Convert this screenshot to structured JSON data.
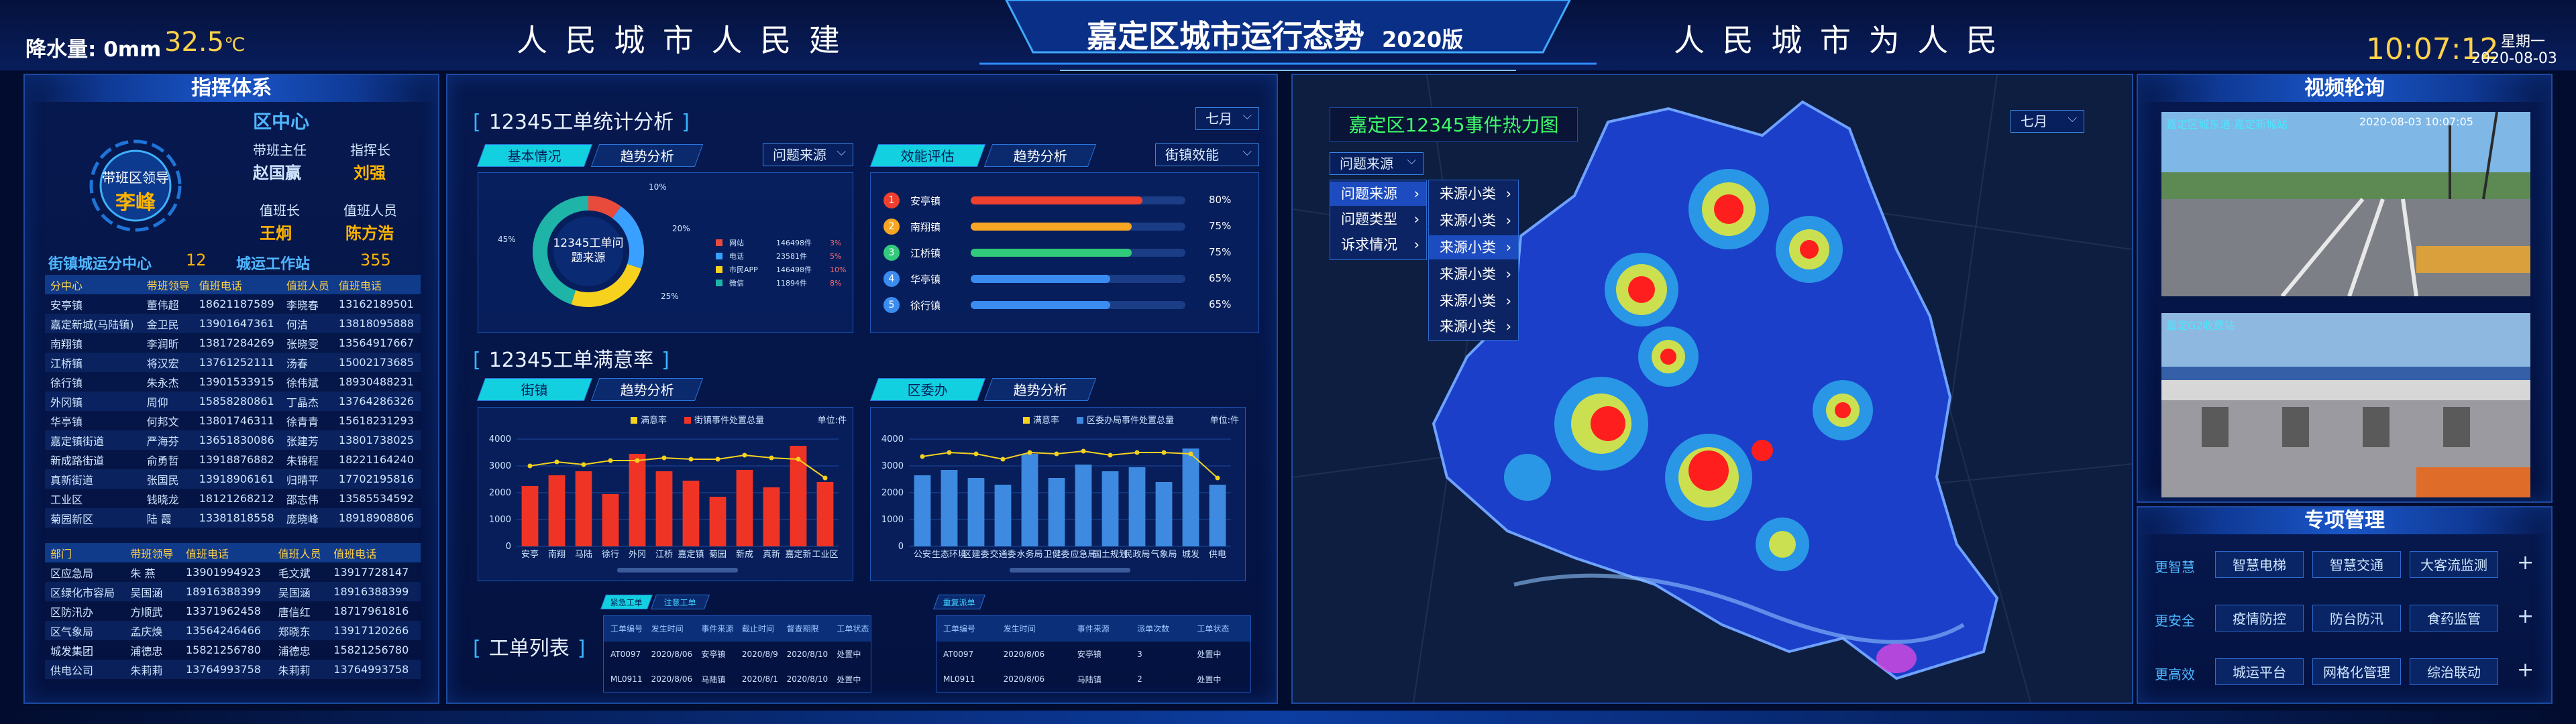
{
  "header": {
    "rain_label": "降水量: 0mm",
    "temp": "32.5",
    "temp_unit": "℃",
    "slogan_left": "人 民 城 市 人 民 建",
    "title": "嘉定区城市运行态势",
    "title_year": "2020版",
    "slogan_right": "人 民 城 市 为 人 民",
    "time": "10:07:12",
    "weekday": "星期一",
    "date": "2020-08-03"
  },
  "command": {
    "title": "指挥体系",
    "center": "区中心",
    "leader_role": "带班区领导",
    "leader_name": "李峰",
    "duty_director_label": "带班主任",
    "duty_director": "赵国赢",
    "commander_label": "指挥长",
    "commander": "刘强",
    "duty_chief_label": "值班长",
    "duty_chief": "王炯",
    "duty_staff_label": "值班人员",
    "duty_staff": "陈方浩",
    "town_center_label": "街镇城运分中心",
    "town_center_count": "12",
    "city_station_label": "城运工作站",
    "city_station_count": "355",
    "table1_headers": [
      "分中心",
      "带班领导",
      "值班电话",
      "值班人员",
      "值班电话"
    ],
    "table1_rows": [
      [
        "安亭镇",
        "董伟超",
        "18621187589",
        "李晓春",
        "13162189501"
      ],
      [
        "嘉定新城(马陆镇)",
        "金卫民",
        "13901647361",
        "何洁",
        "13818095888"
      ],
      [
        "南翔镇",
        "李润昕",
        "13817284269",
        "张晓雯",
        "13564917667"
      ],
      [
        "江桥镇",
        "将汉宏",
        "13761252111",
        "汤春",
        "15002173685"
      ],
      [
        "徐行镇",
        "朱永杰",
        "13901533915",
        "徐伟斌",
        "18930488231"
      ],
      [
        "外冈镇",
        "周仰",
        "15858280861",
        "丁晶杰",
        "13764286326"
      ],
      [
        "华亭镇",
        "何邦文",
        "13801746311",
        "徐青青",
        "15618231293"
      ],
      [
        "嘉定镇街道",
        "严海芬",
        "13651830086",
        "张建芳",
        "13801738025"
      ],
      [
        "新成路街道",
        "俞勇哲",
        "13918876882",
        "朱锦程",
        "18221164240"
      ],
      [
        "真新街道",
        "张国民",
        "13918906161",
        "归晴平",
        "17702195816"
      ],
      [
        "工业区",
        "钱晓龙",
        "18121268212",
        "邵志伟",
        "13585534592"
      ],
      [
        "菊园新区",
        "陆 霞",
        "13381818558",
        "庞晓峰",
        "18918908806"
      ]
    ],
    "table2_headers": [
      "部门",
      "带班领导",
      "值班电话",
      "值班人员",
      "值班电话"
    ],
    "table2_rows": [
      [
        "区应急局",
        "朱 燕",
        "13901994923",
        "毛文斌",
        "13917728147"
      ],
      [
        "区绿化市容局",
        "吴国涵",
        "18916388399",
        "吴国涵",
        "18916388399"
      ],
      [
        "区防汛办",
        "方顺武",
        "13371962458",
        "唐信红",
        "18717961816"
      ],
      [
        "区气象局",
        "孟庆焕",
        "13564246466",
        "郑晓东",
        "13917120266"
      ],
      [
        "城发集团",
        "浦德忠",
        "15821256780",
        "浦德忠",
        "15821256780"
      ],
      [
        "供电公司",
        "朱莉莉",
        "13764993758",
        "朱莉莉",
        "13764993758"
      ]
    ]
  },
  "workorder": {
    "section_title": "12345工单统计分析",
    "month_select": "七月",
    "tab_basic": "基本情况",
    "tab_trend1": "趋势分析",
    "source_select": "问题来源",
    "donut_center": "12345工单问题来源",
    "pie_labels": [
      "10%",
      "20%",
      "25%",
      "45%"
    ],
    "pie_colors": [
      "#e84a3c",
      "#3aa0ff",
      "#f6d21e",
      "#1fb4a8"
    ],
    "pie_legend": [
      [
        "网站",
        "146498件",
        "3%"
      ],
      [
        "电话",
        "23581件",
        "5%"
      ],
      [
        "市民APP",
        "146498件",
        "10%"
      ],
      [
        "微信",
        "11894件",
        "8%"
      ]
    ],
    "tab_eval": "效能评估",
    "tab_trend2": "趋势分析",
    "eval_select": "街镇效能",
    "ranking": [
      {
        "rank": "1",
        "name": "安亭镇",
        "pct": "80%",
        "value": 80,
        "color": "#ef3f2e"
      },
      {
        "rank": "2",
        "name": "南翔镇",
        "pct": "75%",
        "value": 75,
        "color": "#f6a623"
      },
      {
        "rank": "3",
        "name": "江桥镇",
        "pct": "75%",
        "value": 75,
        "color": "#31c97a"
      },
      {
        "rank": "4",
        "name": "华亭镇",
        "pct": "65%",
        "value": 65,
        "color": "#3a8cf0"
      },
      {
        "rank": "5",
        "name": "徐行镇",
        "pct": "65%",
        "value": 65,
        "color": "#3a8cf0"
      }
    ]
  },
  "satisfaction": {
    "section_title": "12345工单满意率",
    "tab_town": "街镇",
    "tab_trend1": "趋势分析",
    "tab_dept": "区委办",
    "tab_trend2": "趋势分析"
  },
  "chart_data": [
    {
      "type": "bar",
      "legend": [
        "满意率",
        "街镇事件处置总量"
      ],
      "unit": "单位:件",
      "ylim": [
        0,
        4000
      ],
      "yticks": [
        "4000",
        "3000",
        "2000",
        "1000",
        "0"
      ],
      "categories": [
        "安亭",
        "南翔",
        "马陆",
        "徐行",
        "外冈",
        "江桥",
        "嘉定镇",
        "菊园",
        "新成",
        "真新",
        "嘉定新",
        "工业区"
      ],
      "series": [
        {
          "name": "街镇事件处置总量",
          "values": [
            2250,
            2650,
            2800,
            1950,
            3450,
            2800,
            2450,
            1850,
            2850,
            2200,
            3750,
            2400
          ]
        },
        {
          "name": "满意率",
          "values": [
            3000,
            3150,
            3050,
            3200,
            3200,
            3300,
            3250,
            3250,
            3400,
            3300,
            3250,
            2550
          ]
        }
      ],
      "bar_color": "#ef3426",
      "line_color": "#f6d21e"
    },
    {
      "type": "bar",
      "legend": [
        "满意率",
        "区委办局事件处置总量"
      ],
      "unit": "单位:件",
      "ylim": [
        0,
        4000
      ],
      "yticks": [
        "4000",
        "3000",
        "2000",
        "1000",
        "0"
      ],
      "categories": [
        "公安",
        "生态环境",
        "区建委",
        "交通委",
        "水务局",
        "卫健委",
        "应急局",
        "国土规划",
        "民政局",
        "气象局",
        "城发",
        "供电"
      ],
      "series": [
        {
          "name": "区委办局事件处置总量",
          "values": [
            2650,
            2850,
            2550,
            2300,
            3450,
            2550,
            3050,
            2800,
            2950,
            2400,
            3650,
            2300
          ]
        },
        {
          "name": "满意率",
          "values": [
            3350,
            3500,
            3450,
            3250,
            3500,
            3450,
            3550,
            3400,
            3500,
            3500,
            3450,
            2550
          ]
        }
      ],
      "bar_color": "#3d8ae0",
      "line_color": "#f6d21e"
    }
  ],
  "orders": {
    "section_title": "工单列表",
    "tab_urgent": "紧急工单",
    "tab_overdue": "注意工单",
    "tab_repeat": "重复派单",
    "headers1": [
      "工单编号",
      "发生时间",
      "事件来源",
      "截止时间",
      "督查期限",
      "工单状态"
    ],
    "rows1": [
      [
        "AT0097",
        "2020/8/06",
        "安亭镇",
        "2020/8/9",
        "2020/8/10",
        "处置中"
      ],
      [
        "ML0911",
        "2020/8/06",
        "马陆镇",
        "2020/8/1",
        "2020/8/10",
        "处置中"
      ]
    ],
    "headers2": [
      "工单编号",
      "发生时间",
      "事件来源",
      "派单次数",
      "工单状态"
    ],
    "rows2": [
      [
        "AT0097",
        "2020/8/06",
        "安亭镇",
        "3",
        "处置中"
      ],
      [
        "ML0911",
        "2020/8/06",
        "马陆镇",
        "2",
        "处置中"
      ]
    ]
  },
  "heatmap": {
    "title": "嘉定区12345事件热力图",
    "month_select": "七月",
    "source_select": "问题来源",
    "menu": [
      "问题来源",
      "问题类型",
      "诉求情况"
    ],
    "submenu": [
      "来源小类",
      "来源小类",
      "来源小类",
      "来源小类",
      "来源小类",
      "来源小类"
    ]
  },
  "video": {
    "title": "视频轮询",
    "cam1_label": "嘉定区城东道·嘉定新城站",
    "cam1_time": "2020-08-03 10:07:05",
    "cam2_label": "嘉定G2收费站"
  },
  "special": {
    "title": "专项管理",
    "rows": [
      {
        "label": "更智慧",
        "items": [
          "智慧电梯",
          "智慧交通",
          "大客流监测"
        ]
      },
      {
        "label": "更安全",
        "items": [
          "疫情防控",
          "防台防汛",
          "食药监管"
        ]
      },
      {
        "label": "更高效",
        "items": [
          "城运平台",
          "网格化管理",
          "综治联动"
        ]
      }
    ],
    "plus": "+"
  }
}
